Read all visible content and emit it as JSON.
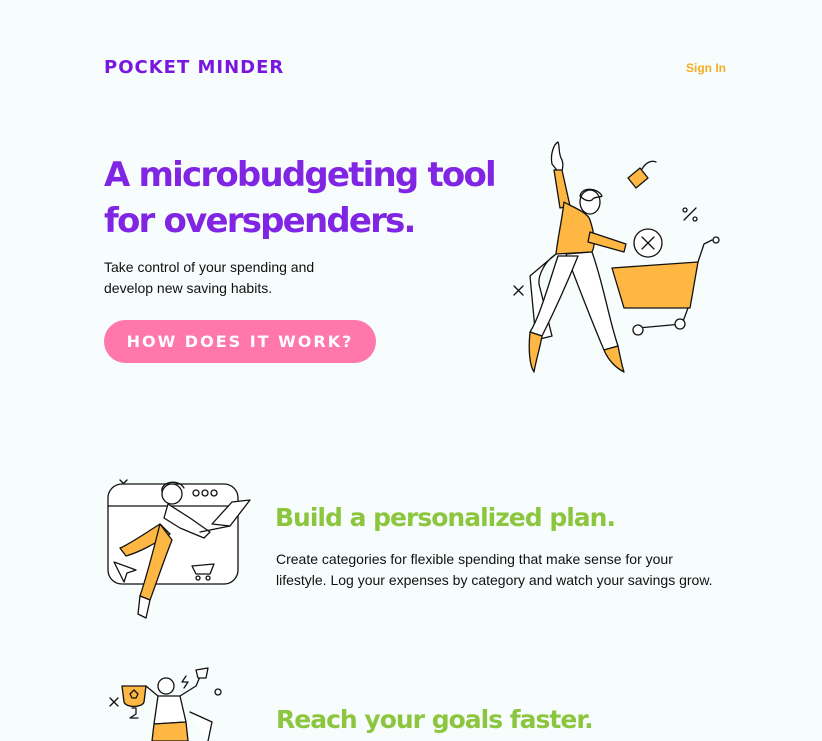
{
  "header": {
    "brand": "POCKET MINDER",
    "sign_in": "Sign In"
  },
  "hero": {
    "title": "A microbudgeting tool for overspenders.",
    "subtitle": "Take control of your spending and develop new saving habits.",
    "cta": "HOW DOES IT WORK?",
    "illustration": "person-shopping-cart-illustration"
  },
  "features": [
    {
      "title": "Build a personalized plan.",
      "text": "Create categories for flexible spending that make sense for your lifestyle. Log your expenses by category and watch your savings grow.",
      "illustration": "person-laptop-browser-illustration"
    },
    {
      "title": "Reach your goals faster.",
      "illustration": "trophy-celebration-illustration"
    }
  ],
  "colors": {
    "background": "#f7fcfd",
    "brand_purple": "#8125e4",
    "accent_orange": "#f7ad22",
    "cta_pink": "#ff77ab",
    "feature_green": "#8cc63f",
    "illustration_fill": "#fdb742"
  }
}
